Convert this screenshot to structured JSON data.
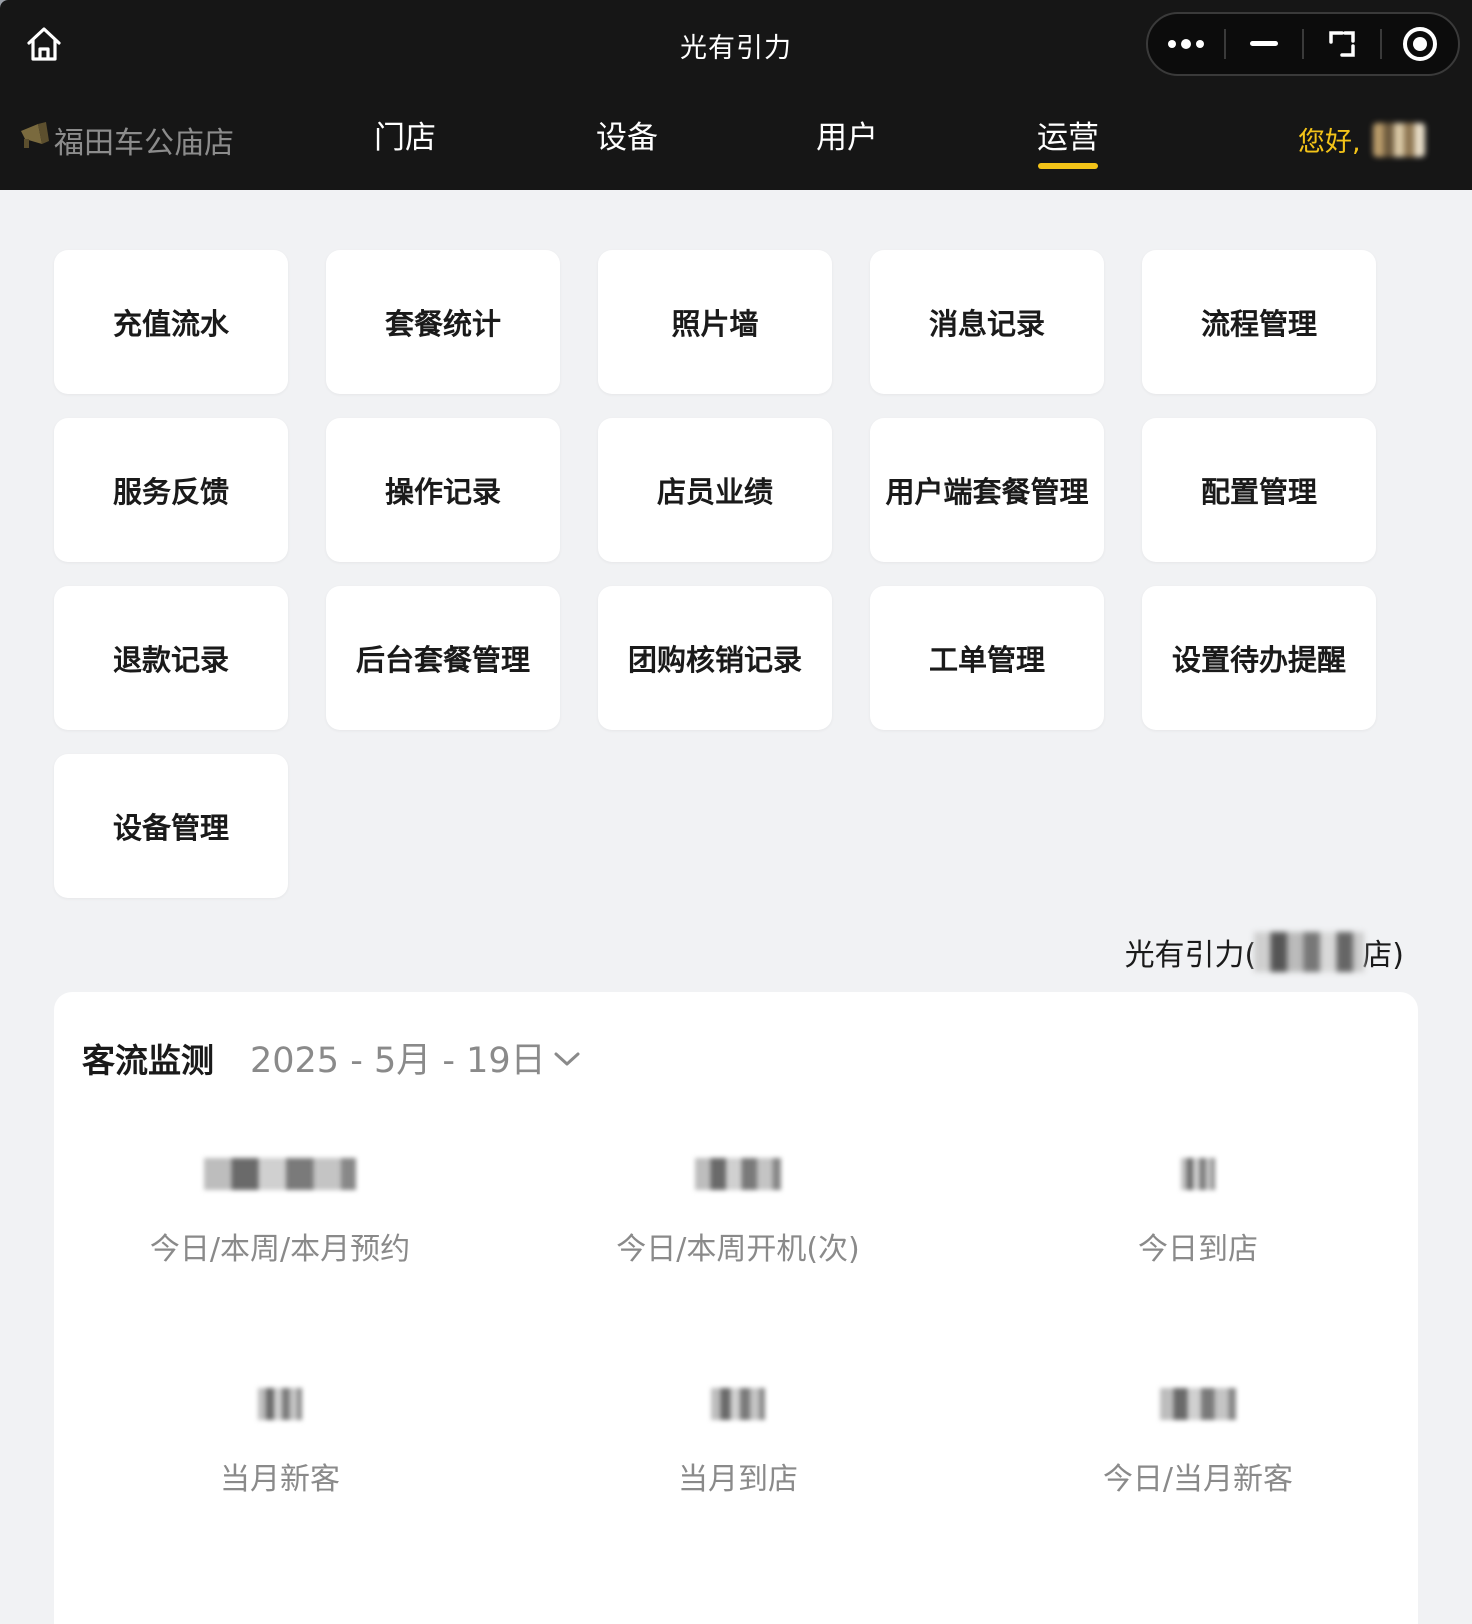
{
  "header": {
    "title": "光有引力",
    "home_icon": "home-icon",
    "capsule_icons": [
      "more-dots-icon",
      "minimize-icon",
      "expand-icon",
      "record-icon"
    ]
  },
  "subnav": {
    "store_name": "福田车公庙店",
    "store_icon": "megaphone-icon",
    "tabs": [
      {
        "label": "门店",
        "active": false
      },
      {
        "label": "设备",
        "active": false
      },
      {
        "label": "用户",
        "active": false
      },
      {
        "label": "运营",
        "active": true
      }
    ],
    "greeting": "您好,"
  },
  "menu": {
    "items": [
      "充值流水",
      "套餐统计",
      "照片墙",
      "消息记录",
      "流程管理",
      "服务反馈",
      "操作记录",
      "店员业绩",
      "用户端套餐管理",
      "配置管理",
      "退款记录",
      "后台套餐管理",
      "团购核销记录",
      "工单管理",
      "设置待办提醒",
      "设备管理"
    ]
  },
  "store_caption": {
    "prefix": "光有引力(",
    "suffix": "店)"
  },
  "monitor": {
    "title": "客流监测",
    "date": "2025 - 5月 - 19日",
    "stats": [
      {
        "label": "今日/本周/本月预约"
      },
      {
        "label": "今日/本周开机(次)"
      },
      {
        "label": "今日到店"
      },
      {
        "label": "当月新客"
      },
      {
        "label": "当月到店"
      },
      {
        "label": "今日/当月新客"
      }
    ]
  },
  "colors": {
    "header_bg": "#161616",
    "accent": "#f3c318",
    "page_bg": "#f1f2f4",
    "card_bg": "#ffffff",
    "muted_text": "#8a8a8a"
  }
}
